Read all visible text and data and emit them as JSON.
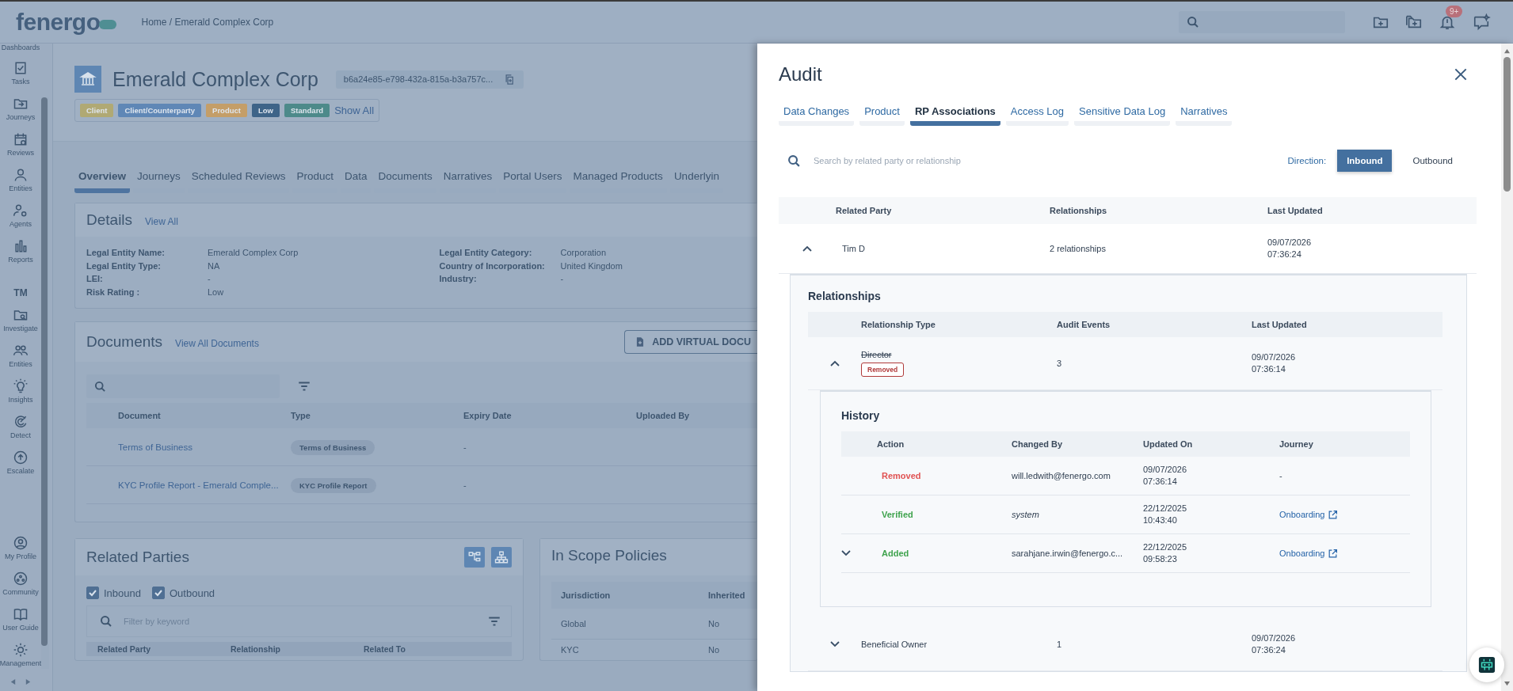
{
  "header": {
    "logo": "fenergo",
    "breadcrumb": "Home / Emerald Complex Corp",
    "notification_count": "9+"
  },
  "sidebar": {
    "items": [
      {
        "label": "Dashboards"
      },
      {
        "label": "Tasks"
      },
      {
        "label": "Journeys"
      },
      {
        "label": "Reviews"
      },
      {
        "label": "Entities"
      },
      {
        "label": "Agents"
      },
      {
        "label": "Reports"
      }
    ],
    "section_label": "TM",
    "tm_items": [
      {
        "label": "Investigate"
      },
      {
        "label": "Entities"
      },
      {
        "label": "Insights"
      },
      {
        "label": "Detect"
      },
      {
        "label": "Escalate"
      }
    ],
    "bottom_items": [
      {
        "label": "My Profile"
      },
      {
        "label": "Community"
      },
      {
        "label": "User Guide"
      },
      {
        "label": "Management"
      }
    ]
  },
  "entity": {
    "name": "Emerald Complex Corp",
    "id": "b6a24e85-e798-432a-815a-b3a757c...",
    "tags": [
      {
        "label": "Client",
        "color": "#b0a974"
      },
      {
        "label": "Client/Counterparty",
        "color": "#5f87b6"
      },
      {
        "label": "Product",
        "color": "#c49e68"
      },
      {
        "label": "Low",
        "color": "#3e6488"
      },
      {
        "label": "Standard",
        "color": "#4d8a8a"
      }
    ],
    "show_all": "Show All"
  },
  "tabs": [
    {
      "label": "Overview",
      "selected": true
    },
    {
      "label": "Journeys",
      "selected": false
    },
    {
      "label": "Scheduled Reviews",
      "selected": false
    },
    {
      "label": "Product",
      "selected": false
    },
    {
      "label": "Data",
      "selected": false
    },
    {
      "label": "Documents",
      "selected": false
    },
    {
      "label": "Narratives",
      "selected": false
    },
    {
      "label": "Portal Users",
      "selected": false
    },
    {
      "label": "Managed Products",
      "selected": false
    },
    {
      "label": "Underlyin",
      "selected": false
    }
  ],
  "details": {
    "title": "Details",
    "link": "View All",
    "left": [
      {
        "label": "Legal Entity Name:",
        "value": "Emerald Complex Corp"
      },
      {
        "label": "Legal Entity Type:",
        "value": "NA"
      },
      {
        "label": "LEI:",
        "value": "-"
      },
      {
        "label": "Risk Rating :",
        "value": "Low"
      }
    ],
    "right": [
      {
        "label": "Legal Entity Category:",
        "value": "Corporation"
      },
      {
        "label": "Country of Incorporation:",
        "value": "United Kingdom"
      },
      {
        "label": "Industry:",
        "value": "-"
      }
    ]
  },
  "documents": {
    "title": "Documents",
    "link": "View All Documents",
    "add_button": "ADD VIRTUAL DOCU",
    "columns": [
      "Document",
      "Type",
      "Expiry Date",
      "Uploaded By"
    ],
    "rows": [
      {
        "document": "Terms of Business",
        "type": "Terms of Business",
        "expiry": "-"
      },
      {
        "document": "KYC Profile Report - Emerald Comple...",
        "type": "KYC Profile Report",
        "expiry": "-"
      }
    ]
  },
  "related_parties": {
    "title": "Related Parties",
    "filters": [
      {
        "label": "Inbound",
        "checked": true
      },
      {
        "label": "Outbound",
        "checked": true
      }
    ],
    "filter_placeholder": "Filter by keyword",
    "columns": [
      "Related Party",
      "Relationship",
      "Related To"
    ]
  },
  "policies": {
    "title": "In Scope Policies",
    "columns": [
      "Jurisdiction",
      "Inherited"
    ],
    "rows": [
      [
        "Global",
        "No"
      ],
      [
        "KYC",
        "No"
      ]
    ]
  },
  "audit": {
    "title": "Audit",
    "tabs": [
      {
        "label": "Data Changes",
        "selected": false
      },
      {
        "label": "Product",
        "selected": false
      },
      {
        "label": "RP Associations",
        "selected": true
      },
      {
        "label": "Access Log",
        "selected": false
      },
      {
        "label": "Sensitive Data Log",
        "selected": false
      },
      {
        "label": "Narratives",
        "selected": false
      }
    ],
    "search_placeholder": "Search by related party or relationship",
    "direction_label": "Direction:",
    "directions": [
      {
        "label": "Inbound",
        "selected": true
      },
      {
        "label": "Outbound",
        "selected": false
      }
    ],
    "columns": [
      "Related Party",
      "Relationships",
      "Last Updated"
    ],
    "parties": [
      {
        "name": "Tim D",
        "relationships": "2 relationships",
        "updated_date": "09/07/2026",
        "updated_time": "07:36:24",
        "expanded": true,
        "relationships_title": "Relationships",
        "relationship_columns": [
          "Relationship Type",
          "Audit Events",
          "Last Updated"
        ],
        "relationship_rows": [
          {
            "type": "Director",
            "removed": true,
            "badge": "Removed",
            "events": "3",
            "updated_date": "09/07/2026",
            "updated_time": "07:36:14",
            "expanded": true,
            "history_title": "History",
            "history_columns": [
              "Action",
              "Changed By",
              "Updated On",
              "Journey"
            ],
            "history": [
              {
                "action": "Removed",
                "kind": "removed",
                "changed_by": "will.ledwith@fenergo.com",
                "system_user": false,
                "date": "09/07/2026",
                "time": "07:36:14",
                "journey": "-",
                "journey_link": false
              },
              {
                "action": "Verified",
                "kind": "verified",
                "changed_by": "system",
                "system_user": true,
                "date": "22/12/2025",
                "time": "10:43:40",
                "journey": "Onboarding",
                "journey_link": true
              },
              {
                "action": "Added",
                "kind": "added",
                "expanded": false,
                "changed_by": "sarahjane.irwin@fenergo.c...",
                "system_user": false,
                "date": "22/12/2025",
                "time": "09:58:23",
                "journey": "Onboarding",
                "journey_link": true
              }
            ]
          },
          {
            "type": "Beneficial Owner",
            "removed": false,
            "events": "1",
            "updated_date": "09/07/2026",
            "updated_time": "07:36:24",
            "expanded": false
          }
        ]
      }
    ]
  }
}
